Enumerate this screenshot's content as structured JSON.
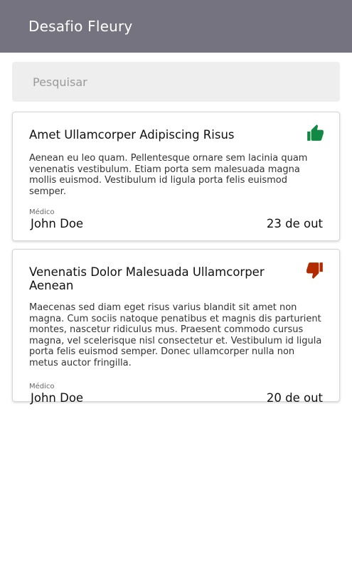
{
  "app_bar": {
    "title": "Desafio Fleury"
  },
  "search": {
    "placeholder": "Pesquisar",
    "value": ""
  },
  "cards": [
    {
      "title": "Amet Ullamcorper Adipiscing Risus",
      "body": "Aenean eu leo quam. Pellentesque ornare sem lacinia quam venenatis vestibulum. Etiam porta sem malesuada magna mollis euismod. Vestibulum id ligula porta felis euismod semper.",
      "role_label": "Médico",
      "doctor": "John Doe",
      "date": "23 de out",
      "rating_icon": "thumbs-up-icon",
      "rating_color": "#118844"
    },
    {
      "title": "Venenatis Dolor Malesuada Ullamcorper Aenean",
      "body": "Maecenas sed diam eget risus varius blandit sit amet non magna. Cum sociis natoque penatibus et magnis dis parturient montes, nascetur ridiculus mus. Praesent commodo cursus magna, vel scelerisque nisl consectetur et. Vestibulum id ligula porta felis euismod semper. Donec ullamcorper nulla non metus auctor fringilla.",
      "role_label": "Médico",
      "doctor": "John Doe",
      "date": "20 de out",
      "rating_icon": "thumbs-down-icon",
      "rating_color": "#b22a00"
    }
  ]
}
